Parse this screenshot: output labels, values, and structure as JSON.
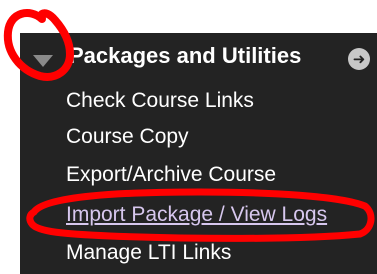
{
  "panel": {
    "title": "Packages and Utilities",
    "collapse_icon": "triangle-down-icon",
    "options_icon": "arrow-right-circle-icon",
    "options_glyph": "➜"
  },
  "menu": {
    "items": [
      {
        "label": "Check Course Links"
      },
      {
        "label": "Course Copy"
      },
      {
        "label": "Export/Archive Course"
      },
      {
        "label": "Import Package / View Logs",
        "highlighted": true
      },
      {
        "label": "Manage LTI Links"
      }
    ]
  },
  "annotations": {
    "color": "#ff0000",
    "circled": "collapse-arrow",
    "underlined": "Import Package / View Logs"
  },
  "colors": {
    "panel_bg": "#232323",
    "text": "#ffffff",
    "highlighted_text": "#d7c7ee",
    "arrow": "#8a8a8a",
    "annotation": "#ff0000"
  }
}
